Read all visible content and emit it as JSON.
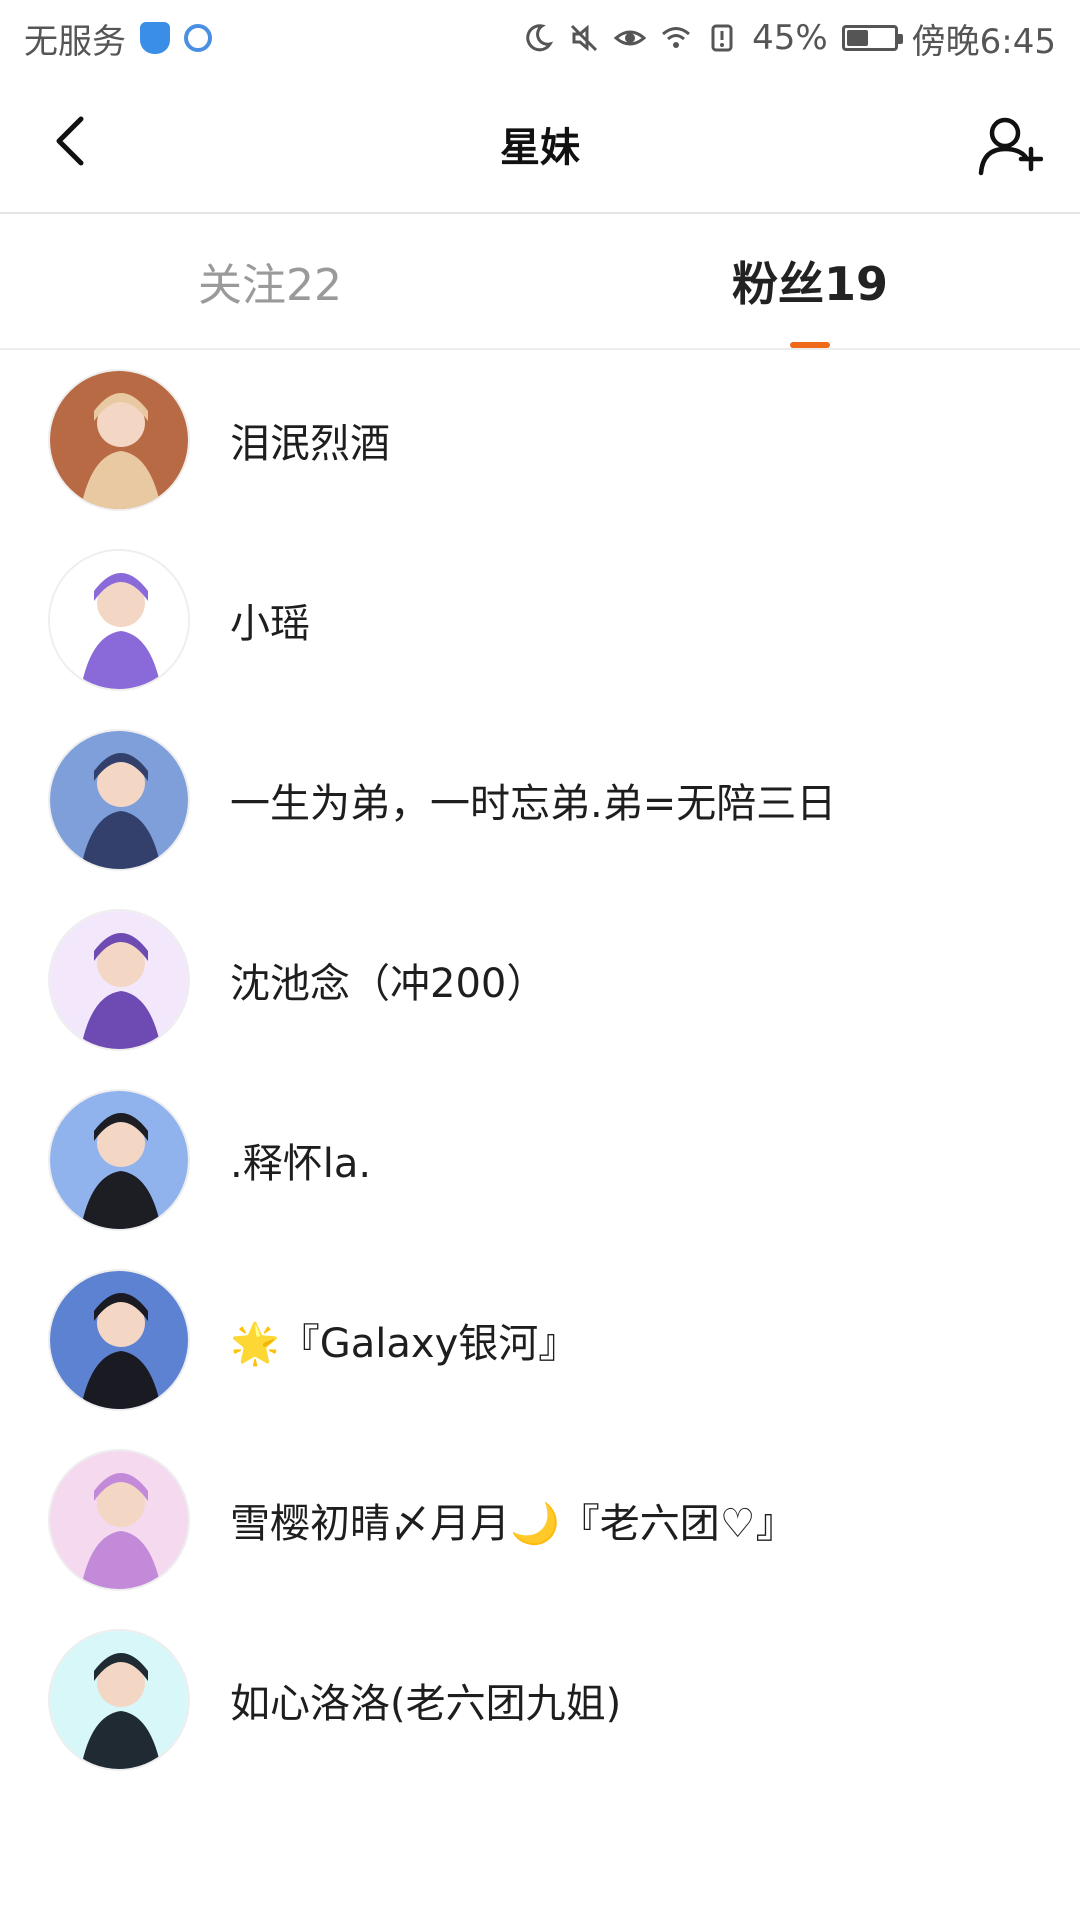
{
  "status_bar": {
    "carrier": "无服务",
    "battery_percent": "45%",
    "battery_level": 0.45,
    "time": "傍晚6:45",
    "icons": [
      "shield-icon",
      "globe-icon",
      "moon-icon",
      "mute-icon",
      "eye-icon",
      "wifi-icon",
      "alert-icon",
      "battery-icon"
    ]
  },
  "header": {
    "title": "星妹",
    "back_icon": "back-arrow-icon",
    "add_icon": "add-user-icon"
  },
  "tabs": [
    {
      "label": "关注22",
      "active": false
    },
    {
      "label": "粉丝19",
      "active": true
    }
  ],
  "accent_color": "#f0691a",
  "followers": [
    {
      "name": "泪泯烈酒",
      "avatar_colors": [
        "#b86a44",
        "#e9c9a1"
      ]
    },
    {
      "name": "小瑶",
      "avatar_colors": [
        "#ffffff",
        "#8a6ad8"
      ]
    },
    {
      "name": "一生为弟，一时忘弟.弟=无陪三日",
      "avatar_colors": [
        "#7e9fd9",
        "#33406b"
      ]
    },
    {
      "name": "沈池念（冲200）",
      "avatar_colors": [
        "#f3e8fb",
        "#6e4bb3"
      ]
    },
    {
      "name": ".释怀la.",
      "avatar_colors": [
        "#90b3ee",
        "#1d1d24"
      ]
    },
    {
      "name": "🌟『Galaxy银河』",
      "avatar_colors": [
        "#5d82d2",
        "#1a1a22"
      ]
    },
    {
      "name": "雪樱初晴〆月月🌙『老六团♡』",
      "avatar_colors": [
        "#f4d9ef",
        "#c28ad9"
      ]
    },
    {
      "name": "如心洛洛(老六团九姐)",
      "avatar_colors": [
        "#d7f7f8",
        "#1f2a33"
      ]
    }
  ]
}
